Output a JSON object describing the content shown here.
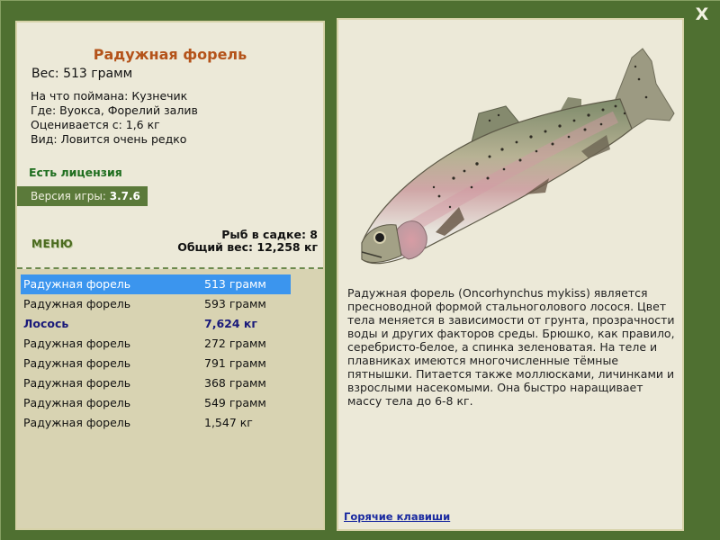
{
  "window": {
    "close_label": "X"
  },
  "fish": {
    "title": "Радужная форель",
    "weight": "Вес: 513 грамм",
    "bait": "На что поймана: Кузнечик",
    "location": "Где: Вуокса, Форелий залив",
    "valued_from": "Оценивается с: 1,6 кг",
    "rarity": "Вид: Ловится очень редко"
  },
  "license": "Есть лицензия",
  "version": {
    "label": "Версия игры: ",
    "value": "3.7.6"
  },
  "menu_label": "МЕНЮ",
  "stats": {
    "count": "Рыб в садке: 8",
    "total_weight": "Общий вес: 12,258 кг"
  },
  "catch_list": [
    {
      "name": "Радужная форель",
      "weight": "513 грамм",
      "selected": true
    },
    {
      "name": "Радужная форель",
      "weight": "593 грамм"
    },
    {
      "name": "Лосось",
      "weight": "7,624 кг",
      "special": true
    },
    {
      "name": "Радужная форель",
      "weight": "272 грамм"
    },
    {
      "name": "Радужная форель",
      "weight": "791 грамм"
    },
    {
      "name": "Радужная форель",
      "weight": "368 грамм"
    },
    {
      "name": "Радужная форель",
      "weight": "549 грамм"
    },
    {
      "name": "Радужная форель",
      "weight": "1,547 кг"
    }
  ],
  "description": "Радужная форель (Oncorhynchus mykiss) является пресноводной формой стальноголового лосося. Цвет тела меняется в зависимости от грунта, прозрачности воды и других факторов среды. Брюшко, как правило, серебристо-белое, а спинка зеленоватая. На теле и плавниках имеются многочисленные тёмные пятнышки. Питается также моллюсками, личинками и взрослыми насекомыми. Она быстро наращивает массу тела до 6-8 кг.",
  "hotkeys_label": "Горячие клавиши",
  "colors": {
    "frame": "#4f7031",
    "panel": "#ece9d8",
    "list_bg": "#d8d3b2",
    "selected_row": "#3b95ee",
    "title": "#b4531a",
    "license": "#1f6e1f"
  }
}
